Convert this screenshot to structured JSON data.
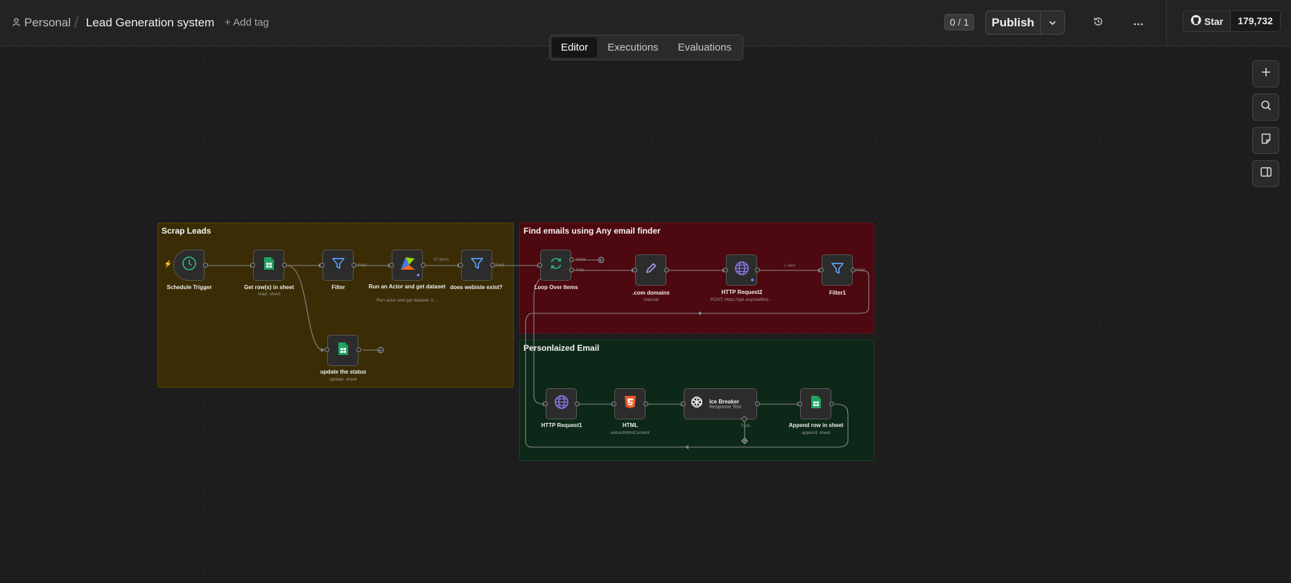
{
  "header": {
    "owner": "Personal",
    "separator": "/",
    "workflow_title": "Lead Generation system",
    "add_tag": "+ Add tag",
    "counter": "0 / 1",
    "publish": "Publish",
    "github_star": "Star",
    "github_count": "179,732"
  },
  "tabs": [
    {
      "label": "Editor",
      "active": true
    },
    {
      "label": "Executions",
      "active": false
    },
    {
      "label": "Evaluations",
      "active": false
    }
  ],
  "side_tools": [
    "plus-icon",
    "search-icon",
    "sticky-note-icon",
    "panel-icon"
  ],
  "sticky_notes": {
    "scrap": "Scrap Leads",
    "find": "Find emails using Any email finder",
    "email": "Personlaized Email"
  },
  "nodes": {
    "schedule": {
      "name": "Schedule Trigger",
      "sub": ""
    },
    "get_rows": {
      "name": "Get row(s) in sheet",
      "sub": "read: sheet"
    },
    "filter": {
      "name": "Filter",
      "sub": ""
    },
    "actor": {
      "name": "Run an Actor and get dataset",
      "sub": "Run actor and get dataset: A..."
    },
    "website": {
      "name": "does webiste exist?",
      "sub": ""
    },
    "update": {
      "name": "update the status",
      "sub": "update: sheet"
    },
    "loop": {
      "name": "Loop Over Items",
      "sub": ""
    },
    "domains": {
      "name": ".com domains",
      "sub": "manual"
    },
    "http2": {
      "name": "HTTP Request2",
      "sub": "POST: https://api.anymailfind..."
    },
    "filter1": {
      "name": "Filter1",
      "sub": ""
    },
    "http1": {
      "name": "HTTP Request1",
      "sub": ""
    },
    "html": {
      "name": "HTML",
      "sub": "extractHtmlContent"
    },
    "ice": {
      "name": "Ice Breaker",
      "sub": "Response Text"
    },
    "append": {
      "name": "Append row in sheet",
      "sub": "append: sheet"
    }
  },
  "edge_labels": {
    "actor_items": "10 items",
    "http2_items": "1 item",
    "kept": "Kept",
    "kept1": "Kept",
    "kept2": "Kept",
    "done": "done",
    "loop": "loop",
    "tools": "Tools"
  },
  "colors": {
    "accent_green": "#2fb27a",
    "sheets_green": "#20a464",
    "filter_blue": "#5aa0f0",
    "globe_purple": "#8a7df0",
    "pencil_purple": "#a89cf5",
    "html_orange": "#e4572e"
  }
}
